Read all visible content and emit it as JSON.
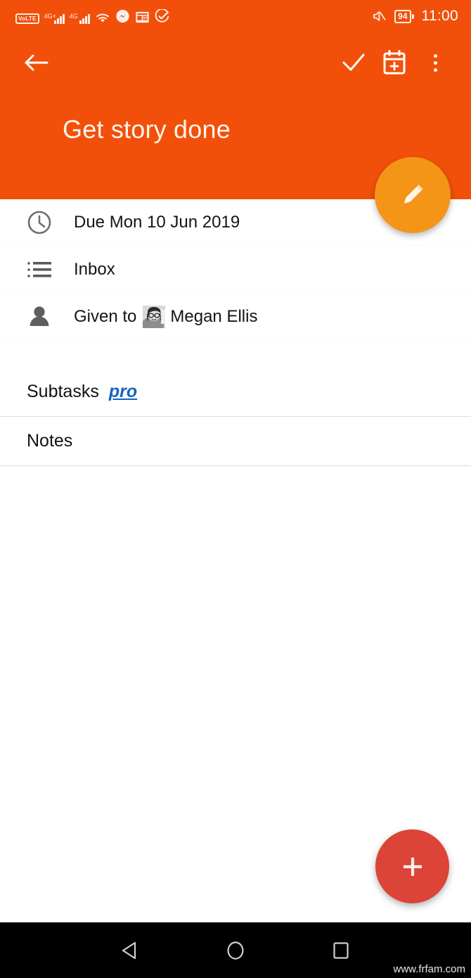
{
  "status_bar": {
    "volte_label": "VoLTE",
    "sim1_network": "4G+",
    "sim2_network": "4G",
    "icons": [
      "volte-badge",
      "signal-bars-sim1",
      "signal-bars-sim2",
      "wifi-icon",
      "messenger-icon",
      "news-icon",
      "check-circle-icon",
      "mute-icon"
    ],
    "battery_percent": "94",
    "time": "11:00",
    "background_color": "#F2500A"
  },
  "app_bar": {
    "back_icon": "arrow-left-icon",
    "complete_icon": "check-icon",
    "add_to_calendar_icon": "calendar-plus-icon",
    "overflow_icon": "more-vertical-icon",
    "title": "Get story done",
    "background_color": "#F2500A",
    "title_color": "#FFF4EC"
  },
  "edit_fab": {
    "icon": "pencil-icon",
    "color": "#F59518"
  },
  "details": [
    {
      "icon": "clock-icon",
      "label": "Due Mon 10 Jun 2019",
      "name": "due-date-row",
      "style": "plain"
    },
    {
      "icon": "list-icon",
      "label": "Inbox",
      "name": "list-row",
      "style": "link"
    }
  ],
  "assignee_row": {
    "icon": "person-icon",
    "prefix": "Given to",
    "avatar": "megan-ellis-avatar",
    "name": "Megan Ellis",
    "name_color": "#1A6BA5"
  },
  "sections": [
    {
      "title": "Subtasks",
      "badge": "pro",
      "badge_color": "#1565C0",
      "name": "subtasks-section"
    },
    {
      "title": "Notes",
      "badge": "",
      "name": "notes-section"
    }
  ],
  "add_fab": {
    "icon": "plus-icon",
    "color": "#DB4437"
  },
  "nav_bar": {
    "back_icon": "nav-back-triangle-icon",
    "home_icon": "nav-home-circle-icon",
    "recents_icon": "nav-recents-square-icon",
    "background_color": "#000000"
  },
  "watermark": "www.frfam.com"
}
